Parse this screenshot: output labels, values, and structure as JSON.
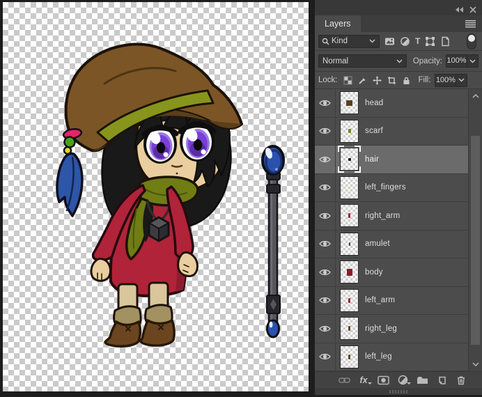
{
  "window": {
    "icons": [
      "collapse-panels-icon",
      "close-icon"
    ]
  },
  "panel": {
    "tab_label": "Layers",
    "menu_icon": "panel-menu-icon",
    "filter_row": {
      "kind_label": "Kind",
      "search_icon": "search-icon",
      "type_icon_label": "T",
      "icons": [
        "pixel-layers-icon",
        "adjustment-layers-icon",
        "type-layers-icon",
        "shape-layers-icon",
        "smart-objects-icon"
      ],
      "toggle_icon": "layer-filtering-toggle"
    },
    "blend_row": {
      "blend_mode": "Normal",
      "opacity_label": "Opacity:",
      "opacity_value": "100%"
    },
    "lock_row": {
      "lock_label": "Lock:",
      "icons": [
        "lock-transparency-icon",
        "lock-paint-icon",
        "lock-position-icon",
        "lock-artboard-icon",
        "lock-all-icon"
      ],
      "fill_label": "Fill:",
      "fill_value": "100%"
    },
    "layers": [
      {
        "name": "head",
        "visible": true,
        "selected": false,
        "glyph_color": "#5b3f1e",
        "glyph_w": 9,
        "glyph_h": 8
      },
      {
        "name": "scarf",
        "visible": true,
        "selected": false,
        "glyph_color": "#7a8818",
        "glyph_w": 4,
        "glyph_h": 6
      },
      {
        "name": "hair",
        "visible": true,
        "selected": true,
        "glyph_color": "#1a1a1a",
        "glyph_w": 4,
        "glyph_h": 4
      },
      {
        "name": "left_fingers",
        "visible": true,
        "selected": false,
        "glyph_color": "#e3c795",
        "glyph_w": 3,
        "glyph_h": 3
      },
      {
        "name": "right_arm",
        "visible": true,
        "selected": false,
        "glyph_color": "#9c2136",
        "glyph_w": 3,
        "glyph_h": 7
      },
      {
        "name": "amulet",
        "visible": true,
        "selected": false,
        "glyph_color": "#3a3a3a",
        "glyph_w": 2,
        "glyph_h": 5
      },
      {
        "name": "body",
        "visible": true,
        "selected": false,
        "glyph_color": "#8e1c2d",
        "glyph_w": 8,
        "glyph_h": 10
      },
      {
        "name": "left_arm",
        "visible": true,
        "selected": false,
        "glyph_color": "#9c2136",
        "glyph_w": 3,
        "glyph_h": 7
      },
      {
        "name": "right_leg",
        "visible": true,
        "selected": false,
        "glyph_color": "#5b4a22",
        "glyph_w": 3,
        "glyph_h": 7
      },
      {
        "name": "left_leg",
        "visible": true,
        "selected": false,
        "glyph_color": "#5b4a22",
        "glyph_w": 3,
        "glyph_h": 7
      }
    ],
    "footer": {
      "fx_label": "fx",
      "icons": [
        "link-layers-icon",
        "layer-styles-fx-icon",
        "layer-mask-icon",
        "adjustment-layer-icon",
        "layer-group-icon",
        "new-layer-icon",
        "delete-layer-icon"
      ]
    }
  },
  "canvas": {
    "checker_light": "#ffffff",
    "checker_dark": "#cacaca",
    "character": {
      "hat": "#7b5526",
      "hat_shadow": "#5c3e19",
      "band": "#87951d",
      "hair": "#191919",
      "skin": "#eace9f",
      "iris_outer": "#9b79e2",
      "iris": "#7a3fd8",
      "iris_dark": "#5c2ba8",
      "scarf": "#6f7d13",
      "scarf_shadow": "#4c560c",
      "dress": "#b12338",
      "dress_shadow": "#8e1c2d",
      "amulet_top": "#55555a",
      "amulet_left": "#3c3c40",
      "amulet_right": "#2c2c30",
      "leg": "#d9c79b",
      "cuff": "#a29161",
      "boot": "#6b451f",
      "staff_rod": "#56565c",
      "staff_band": "#26262c",
      "orb": "#2b51ae",
      "orb_rim": "#16306e",
      "feather": "#2d55a8",
      "bead_pink": "#e82468",
      "bead_green": "#49a315",
      "bead_yellow": "#e6d91a"
    }
  }
}
